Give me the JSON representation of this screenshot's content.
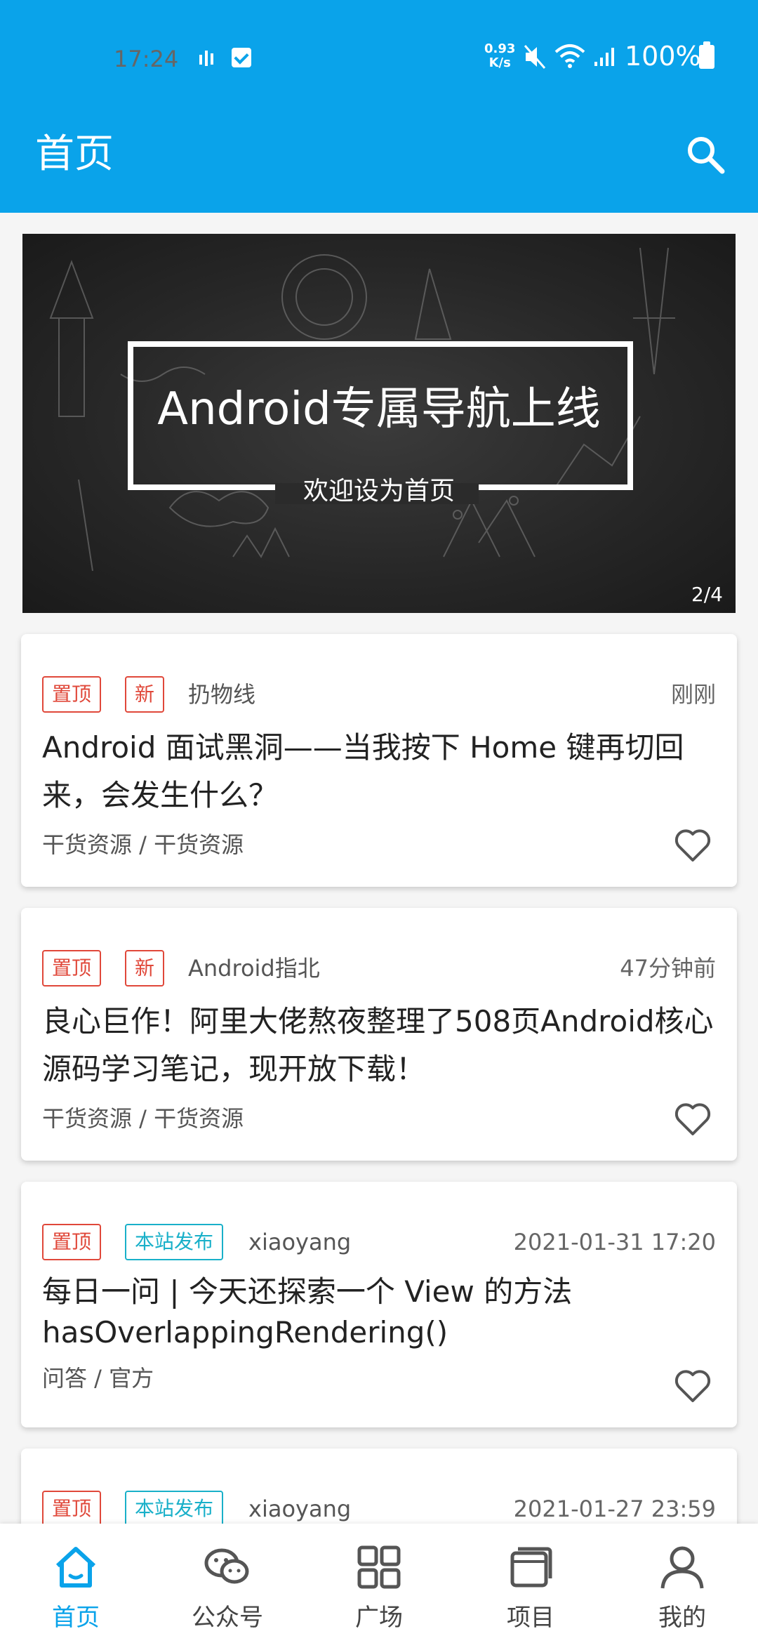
{
  "status_bar": {
    "time": "17:24",
    "speed_top": "0.93",
    "speed_bottom": "K/s",
    "battery": "100%"
  },
  "header": {
    "title": "首页",
    "search_icon": "search-icon",
    "background": "#0aa3ea"
  },
  "banner": {
    "headline": "Android专属导航上线",
    "subtitle": "欢迎设为首页",
    "counter": "2/4"
  },
  "articles": [
    {
      "tags": [
        {
          "label": "置顶",
          "color": "#e0483a"
        },
        {
          "label": "新",
          "color": "#e0483a"
        }
      ],
      "author": "扔物线",
      "time": "刚刚",
      "title": "Android 面试黑洞——当我按下 Home 键再切回来，会发生什么？",
      "chapter": "干货资源 / 干货资源",
      "favorite_icon": "heart-outline-icon"
    },
    {
      "tags": [
        {
          "label": "置顶",
          "color": "#e0483a"
        },
        {
          "label": "新",
          "color": "#e0483a"
        }
      ],
      "author": "Android指北",
      "time": "47分钟前",
      "title": "良心巨作！阿里大佬熬夜整理了508页Android核心源码学习笔记，现开放下载！",
      "chapter": "干货资源 / 干货资源",
      "favorite_icon": "heart-outline-icon"
    },
    {
      "tags": [
        {
          "label": "置顶",
          "color": "#e0483a"
        },
        {
          "label": "本站发布",
          "color": "#19b0c9"
        }
      ],
      "author": "xiaoyang",
      "time": "2021-01-31 17:20",
      "title": "每日一问 | 今天还探索一个 View 的方法 hasOverlappingRendering()",
      "chapter": "问答 / 官方",
      "favorite_icon": "heart-outline-icon"
    },
    {
      "tags": [
        {
          "label": "置顶",
          "color": "#e0483a"
        },
        {
          "label": "本站发布",
          "color": "#19b0c9"
        }
      ],
      "author": "xiaoyang",
      "time": "2021-01-27 23:59"
    }
  ],
  "bottom_nav": [
    {
      "label": "首页",
      "icon": "home-icon",
      "active": true
    },
    {
      "label": "公众号",
      "icon": "wechat-icon",
      "active": false
    },
    {
      "label": "广场",
      "icon": "grid-icon",
      "active": false
    },
    {
      "label": "项目",
      "icon": "project-icon",
      "active": false
    },
    {
      "label": "我的",
      "icon": "profile-icon",
      "active": false
    }
  ]
}
